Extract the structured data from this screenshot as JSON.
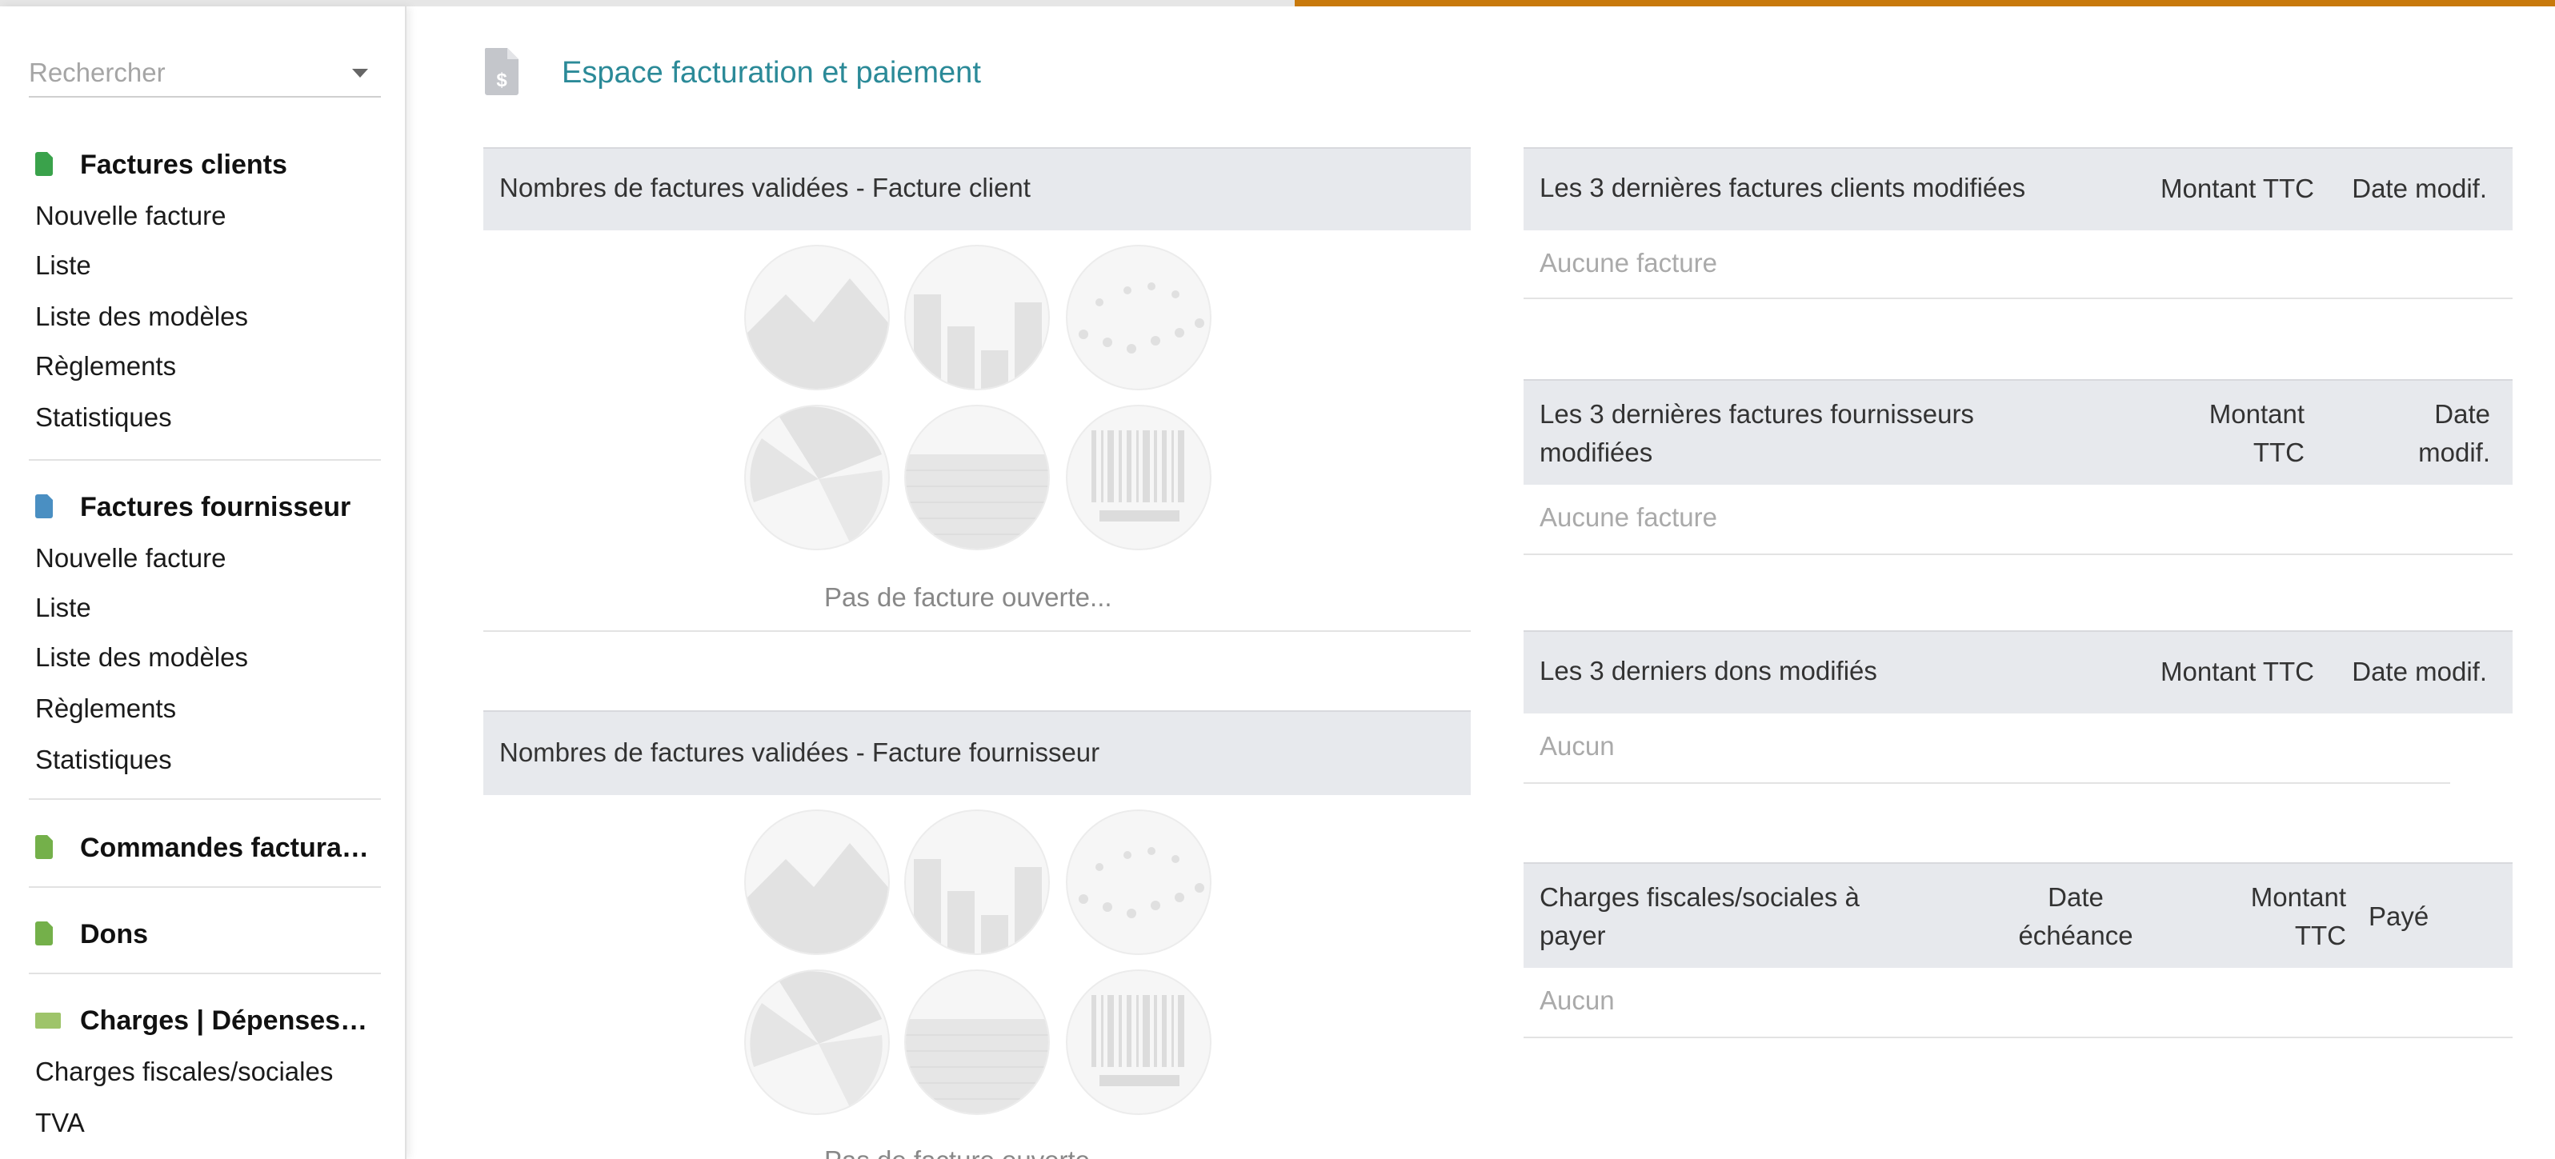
{
  "colors": {
    "accent": "#c8790c",
    "title": "#2b8a98",
    "panel_bg": "#e7e9ed",
    "doc_green": "#3aa24b",
    "doc_blue": "#4a8fc2",
    "doc_olive": "#74b04a"
  },
  "sidebar": {
    "search": {
      "placeholder": "Rechercher"
    },
    "sections": {
      "clients": {
        "title": "Factures clients",
        "icon": "invoice-icon",
        "items": [
          "Nouvelle facture",
          "Liste",
          "Liste des modèles",
          "Règlements",
          "Statistiques"
        ]
      },
      "fournisseur": {
        "title": "Factures fournisseur",
        "icon": "supplier-invoice-icon",
        "items": [
          "Nouvelle facture",
          "Liste",
          "Liste des modèles",
          "Règlements",
          "Statistiques"
        ]
      },
      "commandes": {
        "title": "Commandes factura…",
        "icon": "order-icon"
      },
      "dons": {
        "title": "Dons",
        "icon": "donation-icon"
      },
      "charges": {
        "title": "Charges | Dépenses…",
        "icon": "money-icon",
        "items": [
          "Charges fiscales/sociales",
          "TVA"
        ]
      }
    }
  },
  "main": {
    "title": "Espace facturation et paiement",
    "chart_client": {
      "title": "Nombres de factures validées - Facture client",
      "empty": "Pas de facture ouverte..."
    },
    "chart_fournisseur": {
      "title": "Nombres de factures validées - Facture fournisseur",
      "empty": "Pas de facture ouverte..."
    },
    "last_clients": {
      "title": "Les 3 dernières factures clients modifiées",
      "col_amount": "Montant TTC",
      "col_date": "Date modif.",
      "empty": "Aucune facture"
    },
    "last_suppliers": {
      "title_line1": "Les 3 dernières factures fournisseurs",
      "title_line2": "modifiées",
      "col_amount_1": "Montant",
      "col_amount_2": "TTC",
      "col_date_1": "Date",
      "col_date_2": "modif.",
      "empty": "Aucune facture"
    },
    "last_dons": {
      "title": "Les 3 derniers dons modifiés",
      "col_amount": "Montant TTC",
      "col_date": "Date modif.",
      "empty": "Aucun"
    },
    "charges": {
      "title_line1": "Charges fiscales/sociales à",
      "title_line2": "payer",
      "col_due_1": "Date",
      "col_due_2": "échéance",
      "col_amount_1": "Montant",
      "col_amount_2": "TTC",
      "col_paid": "Payé",
      "empty": "Aucun"
    }
  }
}
